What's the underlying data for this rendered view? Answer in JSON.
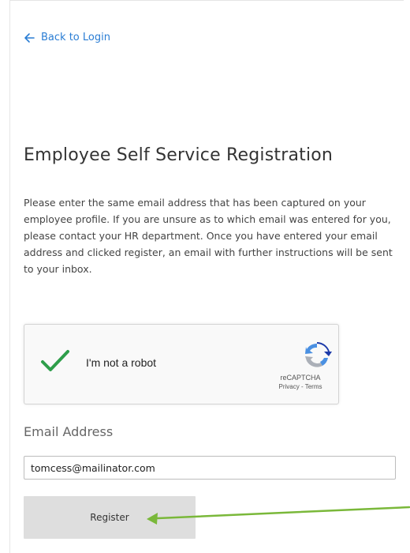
{
  "nav": {
    "back_label": "Back to Login"
  },
  "page": {
    "title": "Employee Self Service Registration",
    "description": "Please enter the same email address that has been captured on your employee profile. If you are unsure as to which email was entered for you, please contact your HR department. Once you have entered your email address and clicked register, an email with further instructions will be sent to your inbox."
  },
  "captcha": {
    "label": "I'm not a robot",
    "checked": true,
    "brand": "reCAPTCHA",
    "links": "Privacy - Terms",
    "icons": [
      "checkmark-icon",
      "recaptcha-logo-icon"
    ]
  },
  "form": {
    "email_label": "Email Address",
    "email_value": "tomcess@mailinator.com",
    "register_label": "Register"
  },
  "annotation": {
    "arrow_color": "#7ab83a",
    "icon": "arrow-pointer-icon"
  },
  "colors": {
    "link": "#2a7dd4",
    "check": "#2e9e4a",
    "button_bg": "#dedede"
  }
}
